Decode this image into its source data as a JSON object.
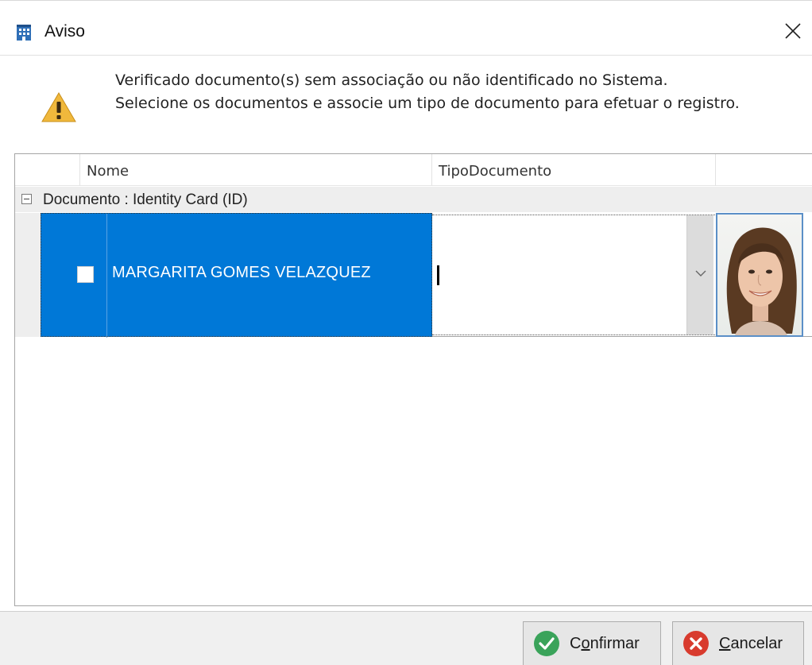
{
  "window": {
    "title": "Aviso"
  },
  "message": {
    "line1": "Verificado documento(s) sem associação ou não identificado no Sistema.",
    "line2": "Selecione os documentos e associe um tipo de documento para efetuar o registro."
  },
  "grid": {
    "columns": [
      "Nome",
      "TipoDocumento",
      ""
    ],
    "group_label": "Documento : Identity Card (ID)",
    "rows": [
      {
        "checked": false,
        "name": "MARGARITA GOMES VELAZQUEZ",
        "tipo_documento": ""
      }
    ]
  },
  "footer": {
    "confirm_label_prefix": "C",
    "confirm_label_underlined": "o",
    "confirm_label_rest": "nfirmar",
    "cancel_label_underlined": "C",
    "cancel_label_rest": "ancelar"
  },
  "colors": {
    "selection": "#0078d7",
    "warning": "#f0b83c",
    "confirm_green": "#3aa35a",
    "cancel_red": "#d83b2e"
  },
  "icons": {
    "app": "building-icon",
    "close": "close-icon",
    "warning": "warning-icon",
    "dropdown": "chevron-down-icon",
    "confirm": "check-circle-icon",
    "cancel": "x-circle-icon"
  }
}
